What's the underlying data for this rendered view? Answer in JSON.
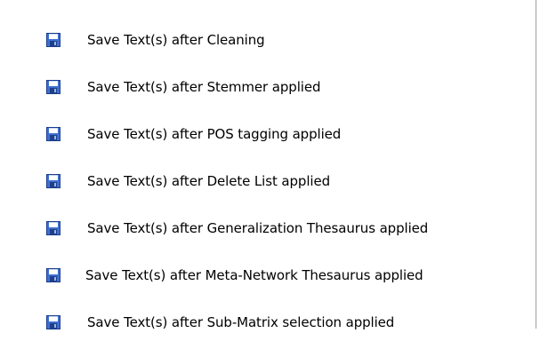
{
  "menu": {
    "icon": "floppy-disk-save-icon",
    "items": [
      {
        "label": "Save Text(s) after Cleaning"
      },
      {
        "label": "Save Text(s) after Stemmer applied"
      },
      {
        "label": "Save Text(s) after POS tagging applied"
      },
      {
        "label": "Save Text(s) after Delete List applied"
      },
      {
        "label": "Save Text(s) after Generalization Thesaurus applied"
      },
      {
        "label": "Save Text(s) after Meta-Network Thesaurus applied"
      },
      {
        "label": "Save Text(s) after Sub-Matrix selection applied"
      }
    ]
  }
}
